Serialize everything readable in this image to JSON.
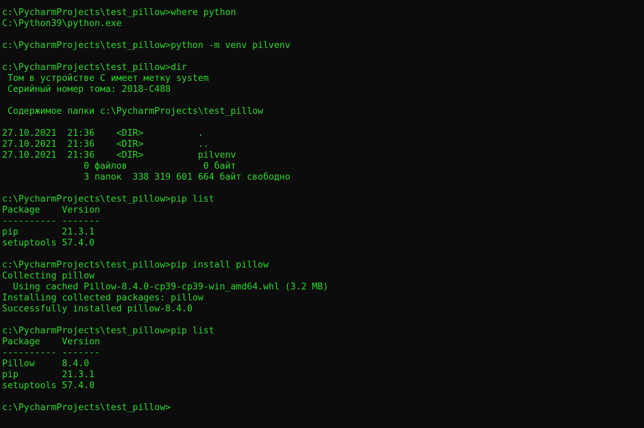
{
  "console": {
    "lines": [
      "c:\\PycharmProjects\\test_pillow>where python",
      "C:\\Python39\\python.exe",
      "",
      "c:\\PycharmProjects\\test_pillow>python -m venv pilvenv",
      "",
      "c:\\PycharmProjects\\test_pillow>dir",
      " Том в устройстве C имеет метку system",
      " Серийный номер тома: 2018-C488",
      "",
      " Содержимое папки c:\\PycharmProjects\\test_pillow",
      "",
      "27.10.2021  21:36    <DIR>          .",
      "27.10.2021  21:36    <DIR>          ..",
      "27.10.2021  21:36    <DIR>          pilvenv",
      "               0 файлов              0 байт",
      "               3 папок  338 319 601 664 байт свободно",
      "",
      "c:\\PycharmProjects\\test_pillow>pip list",
      "Package    Version",
      "---------- -------",
      "pip        21.3.1",
      "setuptools 57.4.0",
      "",
      "c:\\PycharmProjects\\test_pillow>pip install pillow",
      "Collecting pillow",
      "  Using cached Pillow-8.4.0-cp39-cp39-win_amd64.whl (3.2 MB)",
      "Installing collected packages: pillow",
      "Successfully installed pillow-8.4.0",
      "",
      "c:\\PycharmProjects\\test_pillow>pip list",
      "Package    Version",
      "---------- -------",
      "Pillow     8.4.0",
      "pip        21.3.1",
      "setuptools 57.4.0",
      "",
      "c:\\PycharmProjects\\test_pillow>"
    ]
  },
  "colors": {
    "background": "#0c0c0c",
    "text": "#2bd82b"
  }
}
